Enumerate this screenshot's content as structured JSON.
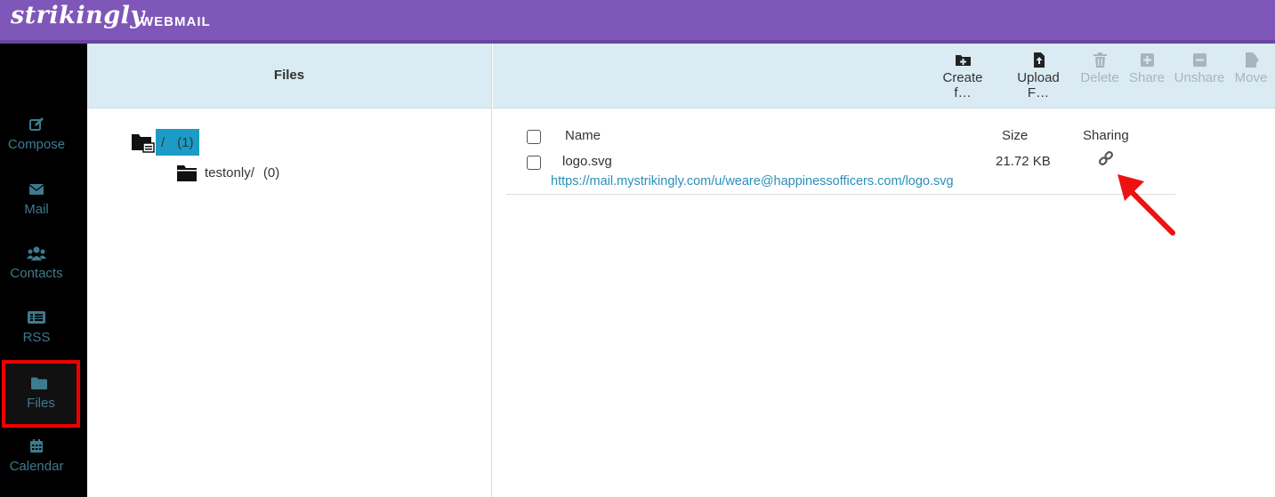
{
  "app": {
    "brand": "strikingly",
    "product": "WEBMAIL"
  },
  "sidebar": {
    "items": [
      {
        "label": "Compose",
        "icon": "compose-icon"
      },
      {
        "label": "Mail",
        "icon": "mail-icon"
      },
      {
        "label": "Contacts",
        "icon": "contacts-icon"
      },
      {
        "label": "RSS",
        "icon": "rss-icon"
      },
      {
        "label": "Files",
        "icon": "folder-icon",
        "active": true
      },
      {
        "label": "Calendar",
        "icon": "calendar-icon"
      }
    ]
  },
  "folders": {
    "title": "Files",
    "root": {
      "name": "/",
      "count": "(1)"
    },
    "children": [
      {
        "name": "testonly/",
        "count": "(0)"
      }
    ]
  },
  "toolbar": {
    "buttons": [
      {
        "label": "Create f…",
        "icon": "folder-plus-icon",
        "enabled": true
      },
      {
        "label": "Upload F…",
        "icon": "file-upload-icon",
        "enabled": true
      },
      {
        "label": "Delete",
        "icon": "trash-icon",
        "enabled": false
      },
      {
        "label": "Share",
        "icon": "plus-square-icon",
        "enabled": false
      },
      {
        "label": "Unshare",
        "icon": "minus-square-icon",
        "enabled": false
      },
      {
        "label": "Move",
        "icon": "file-move-icon",
        "enabled": false
      }
    ]
  },
  "files": {
    "columns": {
      "name": "Name",
      "size": "Size",
      "sharing": "Sharing"
    },
    "rows": [
      {
        "name": "logo.svg",
        "size": "21.72 KB",
        "sharing_icon": "link-icon",
        "share_url": "https://mail.mystrikingly.com/u/weare@happinessofficers.com/logo.svg"
      }
    ]
  },
  "colors": {
    "topbar": "#7f57b8",
    "accent": "#1c9bc6",
    "highlight_box": "#ee0000",
    "arrow": "#ee1111"
  }
}
